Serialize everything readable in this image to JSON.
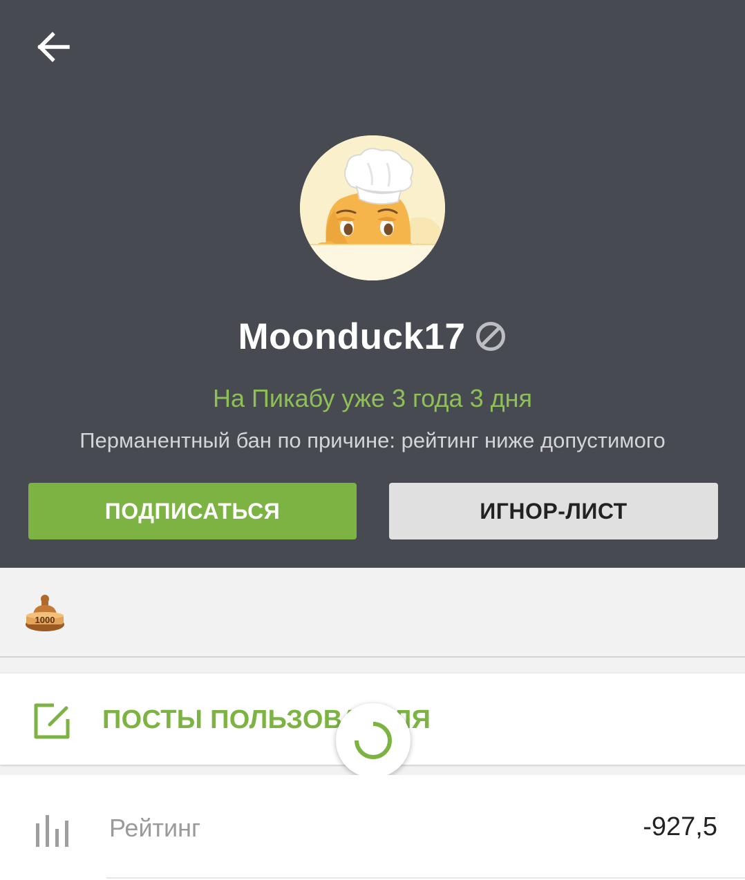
{
  "header": {
    "back_icon": "arrow-left-icon",
    "username": "Moonduck17",
    "ban_icon": "ban-icon",
    "since": "На Пикабу уже 3 года 3 дня",
    "ban_reason": "Перманентный бан по причине: рейтинг ниже допустимого",
    "subscribe_label": "ПОДПИСАТЬСЯ",
    "ignore_label": "ИГНОР-ЛИСТ"
  },
  "awards": {
    "items": [
      {
        "icon": "award-1000-icon",
        "text": "1000"
      }
    ]
  },
  "posts": {
    "label": "ПОСТЫ ПОЛЬЗОВАТЕЛЯ",
    "icon": "edit-icon"
  },
  "stats": {
    "rating_label": "Рейтинг",
    "rating_value": "-927,5",
    "icon": "bar-chart-icon"
  },
  "colors": {
    "header_bg": "#474a51",
    "accent_green": "#7cb342",
    "since_green": "#8fc058"
  }
}
